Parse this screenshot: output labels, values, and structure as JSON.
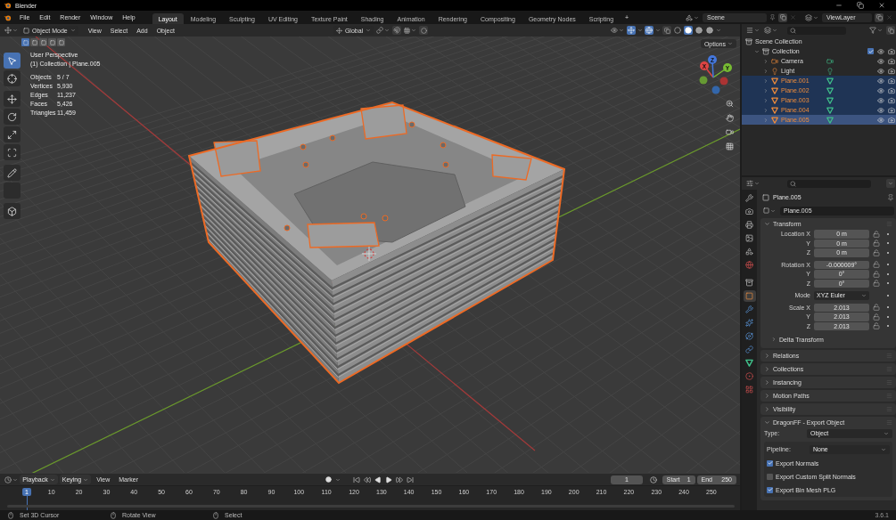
{
  "title_bar": {
    "title": "Blender"
  },
  "menus": [
    "File",
    "Edit",
    "Render",
    "Window",
    "Help"
  ],
  "workspaces": [
    {
      "label": "Layout",
      "selected": true
    },
    {
      "label": "Modeling",
      "selected": false
    },
    {
      "label": "Sculpting",
      "selected": false
    },
    {
      "label": "UV Editing",
      "selected": false
    },
    {
      "label": "Texture Paint",
      "selected": false
    },
    {
      "label": "Shading",
      "selected": false
    },
    {
      "label": "Animation",
      "selected": false
    },
    {
      "label": "Rendering",
      "selected": false
    },
    {
      "label": "Compositing",
      "selected": false
    },
    {
      "label": "Geometry Nodes",
      "selected": false
    },
    {
      "label": "Scripting",
      "selected": false
    }
  ],
  "add_workspace": "+",
  "scene": {
    "name": "Scene"
  },
  "view_layer": {
    "name": "ViewLayer"
  },
  "viewport": {
    "mode": "Object Mode",
    "menus": [
      "View",
      "Select",
      "Add",
      "Object"
    ],
    "orientation": "Global",
    "options": "Options",
    "select_modes": [
      {
        "selected": true
      },
      {
        "selected": false
      },
      {
        "selected": false
      },
      {
        "selected": false
      },
      {
        "selected": false
      }
    ],
    "shading_modes": [
      {
        "kind": "wireframe",
        "selected": false
      },
      {
        "kind": "solid",
        "selected": true
      },
      {
        "kind": "material",
        "selected": false
      },
      {
        "kind": "rendered",
        "selected": false
      }
    ],
    "tools": [
      {
        "kind": "select",
        "selected": true
      },
      {
        "kind": "cursor",
        "selected": false
      },
      {
        "kind": "move",
        "selected": false
      },
      {
        "kind": "rotate",
        "selected": false
      },
      {
        "kind": "scale",
        "selected": false
      },
      {
        "kind": "transform",
        "selected": false
      },
      {
        "kind": "annotate",
        "selected": false
      },
      {
        "kind": "measure",
        "selected": false
      },
      {
        "kind": "add_cube",
        "selected": false
      }
    ],
    "info": {
      "view": "User Perspective",
      "context": "(1) Collection | Plane.005"
    },
    "stats": [
      {
        "label": "Objects",
        "value": "5 / 7"
      },
      {
        "label": "Vertices",
        "value": "5,930"
      },
      {
        "label": "Edges",
        "value": "11,237"
      },
      {
        "label": "Faces",
        "value": "5,426"
      },
      {
        "label": "Triangles",
        "value": "11,459"
      }
    ],
    "gizmo_axes": [
      "X",
      "Y",
      "Z"
    ]
  },
  "outliner": {
    "root": "Scene Collection",
    "items": [
      {
        "name": "Collection",
        "kind": "collection",
        "expanded": true,
        "selected": false,
        "active": false,
        "checked": true,
        "children": [
          {
            "name": "Camera",
            "kind": "camera",
            "expanded": false,
            "selected": false,
            "active": false
          },
          {
            "name": "Light",
            "kind": "light",
            "expanded": false,
            "selected": false,
            "active": false
          },
          {
            "name": "Plane.001",
            "kind": "mesh",
            "expanded": false,
            "selected": true,
            "active": false
          },
          {
            "name": "Plane.002",
            "kind": "mesh",
            "expanded": false,
            "selected": true,
            "active": false
          },
          {
            "name": "Plane.003",
            "kind": "mesh",
            "expanded": false,
            "selected": true,
            "active": false
          },
          {
            "name": "Plane.004",
            "kind": "mesh",
            "expanded": false,
            "selected": true,
            "active": false
          },
          {
            "name": "Plane.005",
            "kind": "mesh",
            "expanded": false,
            "selected": true,
            "active": true
          }
        ]
      }
    ]
  },
  "properties": {
    "tabs": [
      {
        "kind": "tool",
        "selected": false
      },
      {
        "kind": "render",
        "selected": false
      },
      {
        "kind": "output",
        "selected": false
      },
      {
        "kind": "view_layer",
        "selected": false
      },
      {
        "kind": "scene",
        "selected": false
      },
      {
        "kind": "world",
        "selected": false
      },
      {
        "kind": "collection",
        "selected": false
      },
      {
        "kind": "object",
        "selected": true
      },
      {
        "kind": "modifiers",
        "selected": false
      },
      {
        "kind": "particles",
        "selected": false
      },
      {
        "kind": "physics",
        "selected": false
      },
      {
        "kind": "constraints",
        "selected": false
      },
      {
        "kind": "data",
        "selected": false
      },
      {
        "kind": "material",
        "selected": false
      },
      {
        "kind": "texture",
        "selected": false
      }
    ],
    "object_name": "Plane.005",
    "data_name": "Plane.005",
    "transform": {
      "title": "Transform",
      "expanded": true,
      "groups": [
        {
          "kind": "fields",
          "rows": [
            {
              "label": "Location X",
              "value": "0 m"
            },
            {
              "label": "Y",
              "value": "0 m"
            },
            {
              "label": "Z",
              "value": "0 m"
            }
          ]
        },
        {
          "kind": "fields",
          "rows": [
            {
              "label": "Rotation X",
              "value": "-0.000009°"
            },
            {
              "label": "Y",
              "value": "0°"
            },
            {
              "label": "Z",
              "value": "0°"
            }
          ]
        },
        {
          "kind": "dropdown",
          "rows": [
            {
              "label": "Mode",
              "value": "XYZ Euler"
            }
          ]
        },
        {
          "kind": "fields",
          "rows": [
            {
              "label": "Scale X",
              "value": "2.013"
            },
            {
              "label": "Y",
              "value": "2.013"
            },
            {
              "label": "Z",
              "value": "2.013"
            }
          ]
        }
      ],
      "subpanel": {
        "title": "Delta Transform",
        "expanded": false
      }
    },
    "panels": [
      {
        "title": "Relations",
        "expanded": false
      },
      {
        "title": "Collections",
        "expanded": false
      },
      {
        "title": "Instancing",
        "expanded": false
      },
      {
        "title": "Motion Paths",
        "expanded": false
      },
      {
        "title": "Visibility",
        "expanded": false
      }
    ],
    "export": {
      "title": "DragonFF - Export Object",
      "expanded": true,
      "type_label": "Type:",
      "type": "Object",
      "pipeline_label": "Pipeline:",
      "pipeline": "None",
      "options": [
        {
          "label": "Export Normals",
          "checked": true
        },
        {
          "label": "Export Custom Split Normals",
          "checked": false
        },
        {
          "label": "Export Bin Mesh PLG",
          "checked": true
        }
      ]
    }
  },
  "timeline": {
    "menus": [
      "Playback",
      "Keying",
      "View",
      "Marker"
    ],
    "frame": "1",
    "start_label": "Start",
    "start": "1",
    "end_label": "End",
    "end": "250",
    "playhead": "1",
    "ruler": [
      "10",
      "20",
      "30",
      "40",
      "50",
      "60",
      "70",
      "80",
      "90",
      "100",
      "110",
      "120",
      "130",
      "140",
      "150",
      "160",
      "170",
      "180",
      "190",
      "200",
      "210",
      "220",
      "230",
      "240",
      "250"
    ]
  },
  "status_bar": {
    "hints": [
      "Set 3D Cursor",
      "Rotate View",
      "Select"
    ],
    "version": "3.6.1"
  }
}
